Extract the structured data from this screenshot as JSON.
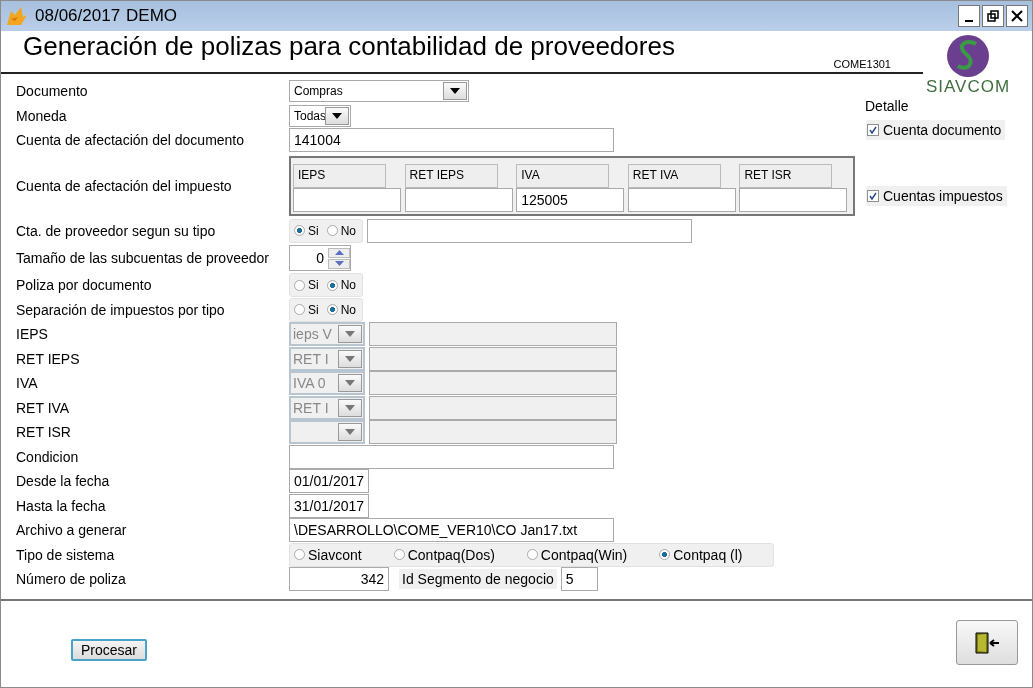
{
  "window": {
    "date": "08/06/2017",
    "mode": "DEMO"
  },
  "header": {
    "title": "Generación de polizas para contabilidad de proveedores",
    "code": "COME1301",
    "logo_text": "SIAVCOM"
  },
  "form": {
    "rows": [
      {
        "kind": "select",
        "label": "Documento",
        "value": "Compras"
      },
      {
        "kind": "short_select",
        "label": "Moneda",
        "value": "Todas"
      },
      {
        "kind": "text",
        "label": "Cuenta de afectación del documento",
        "value": "141004"
      },
      {
        "kind": "tax_grid",
        "label": "Cuenta de afectación del impuesto",
        "columns": [
          {
            "header": "IEPS"
          },
          {
            "header": "RET IEPS"
          },
          {
            "header": "IVA",
            "value": "125005"
          },
          {
            "header": "RET IVA"
          },
          {
            "header": "RET ISR"
          }
        ]
      },
      {
        "kind": "radio_field",
        "label": "Cta. de proveedor segun su tipo",
        "options": [
          {
            "label": "Si",
            "selected": true
          },
          {
            "label": "No",
            "selected": false
          }
        ]
      },
      {
        "kind": "spinner",
        "label": "Tamaño de las subcuentas de proveedor",
        "value": "0"
      },
      {
        "kind": "radio",
        "label": "Poliza por documento",
        "options": [
          {
            "label": "Si",
            "selected": false
          },
          {
            "label": "No",
            "selected": true
          }
        ]
      },
      {
        "kind": "radio",
        "label": "Separación de impuestos por tipo",
        "options": [
          {
            "label": "Si",
            "selected": false
          },
          {
            "label": "No",
            "selected": true
          }
        ]
      },
      {
        "kind": "combo_field",
        "label": "IEPS",
        "value": "ieps V",
        "disabled": true
      },
      {
        "kind": "combo_field",
        "label": "RET IEPS",
        "value": "RET I",
        "disabled": true
      },
      {
        "kind": "combo_field",
        "label": "IVA",
        "value": "IVA 0",
        "disabled": true
      },
      {
        "kind": "combo_field",
        "label": "RET IVA",
        "value": "RET I",
        "disabled": true
      },
      {
        "kind": "combo_field",
        "label": "RET ISR",
        "disabled": true
      },
      {
        "kind": "text",
        "label": "Condicion"
      },
      {
        "kind": "date",
        "label": "Desde la fecha",
        "value": "01/01/2017"
      },
      {
        "kind": "date",
        "label": "Hasta la fecha",
        "value": "31/01/2017"
      },
      {
        "kind": "text",
        "label": "Archivo a generar",
        "value": "\\DESARROLLO\\COME_VER10\\CO Jan17.txt"
      },
      {
        "kind": "radio_wide",
        "label": "Tipo de sistema",
        "options": [
          {
            "label": "Siavcont",
            "selected": false
          },
          {
            "label": "Contpaq(Dos)",
            "selected": false
          },
          {
            "label": "Contpaq(Win)",
            "selected": false
          },
          {
            "label": "Contpaq (l)",
            "selected": true
          }
        ]
      },
      {
        "kind": "number_segment",
        "label": "Número de poliza",
        "value": "342",
        "extra_label": "Id Segmento de negocio",
        "extra_value": "5"
      }
    ]
  },
  "detail": {
    "title": "Detalle",
    "checks": [
      {
        "label": "Cuenta documento",
        "checked": true
      },
      {
        "label": "Cuentas impuestos",
        "checked": true
      }
    ]
  },
  "footer": {
    "process_button": "Procesar"
  }
}
